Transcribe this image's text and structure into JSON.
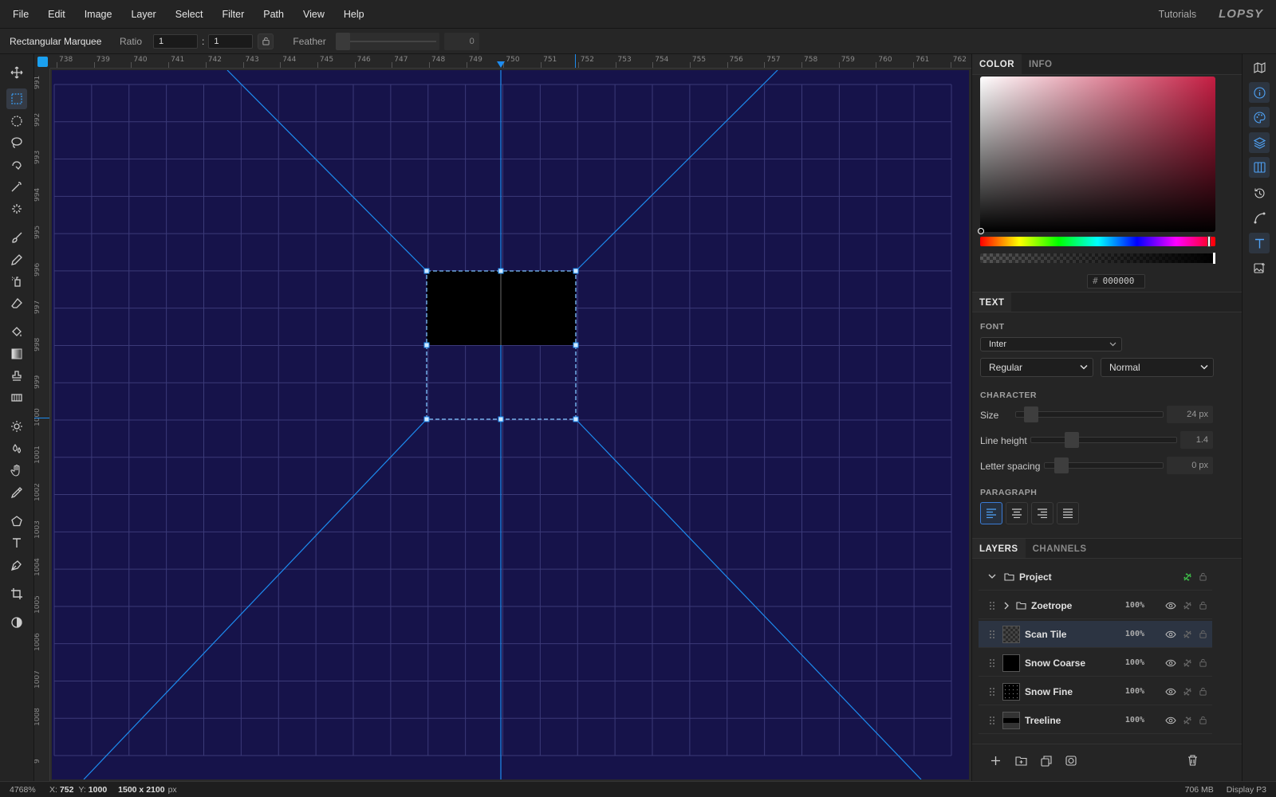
{
  "menubar": {
    "items": [
      "File",
      "Edit",
      "Image",
      "Layer",
      "Select",
      "Filter",
      "Path",
      "View",
      "Help"
    ],
    "tutorials": "Tutorials",
    "logo": "LOPSY"
  },
  "options": {
    "tool_name": "Rectangular Marquee",
    "ratio_label": "Ratio",
    "ratio_w": "1",
    "ratio_sep": ":",
    "ratio_h": "1",
    "feather_label": "Feather",
    "feather_value": "0"
  },
  "ruler": {
    "top": [
      "738",
      "739",
      "740",
      "741",
      "742",
      "743",
      "744",
      "745",
      "746",
      "747",
      "748",
      "749",
      "750",
      "751",
      "752",
      "753",
      "754",
      "755",
      "756",
      "757",
      "758",
      "759",
      "760",
      "761",
      "762"
    ],
    "left": [
      "991",
      "992",
      "993",
      "994",
      "995",
      "996",
      "997",
      "998",
      "999",
      "1000",
      "1001",
      "1002",
      "1003",
      "1004",
      "1005",
      "1006",
      "1007",
      "1008",
      "9"
    ]
  },
  "color_panel": {
    "tabs": [
      "COLOR",
      "INFO"
    ],
    "hex_prefix": "#",
    "hex": "000000"
  },
  "text_panel": {
    "tab": "TEXT",
    "font_label": "FONT",
    "font_family": "Inter",
    "font_weight": "Regular",
    "font_style": "Normal",
    "character_label": "CHARACTER",
    "size_label": "Size",
    "size_value": "24 px",
    "line_height_label": "Line height",
    "line_height_value": "1.4",
    "letter_spacing_label": "Letter spacing",
    "letter_spacing_value": "0 px",
    "paragraph_label": "PARAGRAPH"
  },
  "layers_panel": {
    "tabs": [
      "LAYERS",
      "CHANNELS"
    ],
    "layers": [
      {
        "name": "Project",
        "opacity": ""
      },
      {
        "name": "Zoetrope",
        "opacity": "100%"
      },
      {
        "name": "Scan Tile",
        "opacity": "100%"
      },
      {
        "name": "Snow Coarse",
        "opacity": "100%"
      },
      {
        "name": "Snow Fine",
        "opacity": "100%"
      },
      {
        "name": "Treeline",
        "opacity": "100%"
      }
    ]
  },
  "status": {
    "zoom": "4768%",
    "x_label": "X:",
    "x": "752",
    "y_label": "Y:",
    "y": "1000",
    "dims": "1500 x 2100",
    "dims_unit": "px",
    "memory": "706 MB",
    "display": "Display P3"
  },
  "colors": {
    "accent": "#3a9bf0",
    "canvas_bg": "#16134a",
    "guide": "#1d8cf0"
  }
}
